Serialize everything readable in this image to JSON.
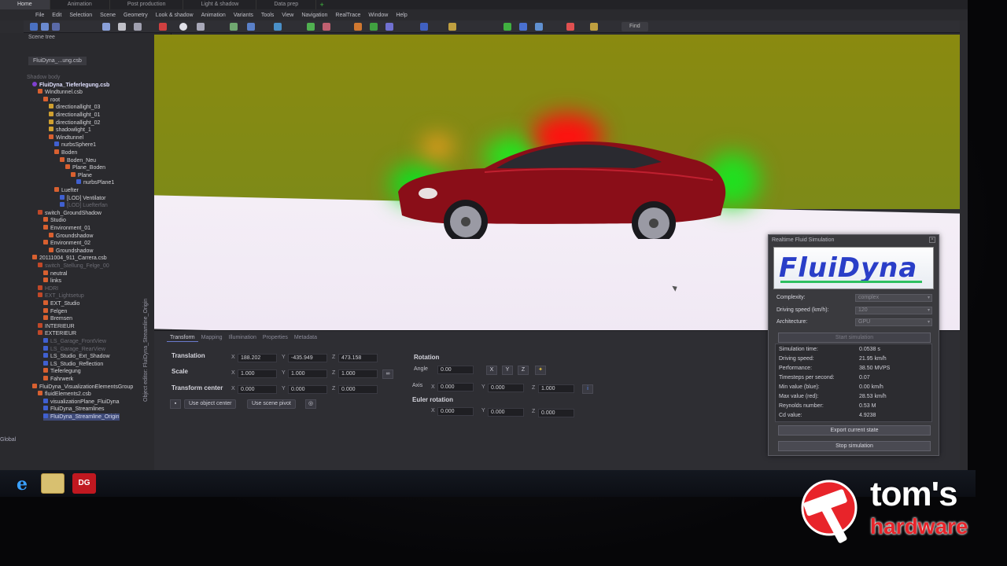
{
  "top_tabs": [
    "Home",
    "Animation",
    "Post production",
    "Light & shadow",
    "Data prep"
  ],
  "menu": [
    "File",
    "Edit",
    "Selection",
    "Scene",
    "Geometry",
    "Look & shadow",
    "Animation",
    "Variants",
    "Tools",
    "View",
    "Navigation",
    "RealTrace",
    "Window",
    "Help"
  ],
  "toolbar": {
    "find_label": "Find"
  },
  "scene_tree": {
    "title": "Scene tree",
    "file_tab": "FluiDyna_...ung.csb",
    "global_label": "Global",
    "items": [
      {
        "label": "Shadow body",
        "indent": 0,
        "icon": "none",
        "style": "dim"
      },
      {
        "label": "FluiDyna_Tieferlegung.csb",
        "indent": 1,
        "icon": "root",
        "style": "bold"
      },
      {
        "label": "Windtunnel.csb",
        "indent": 2,
        "icon": "folder",
        "style": ""
      },
      {
        "label": "root",
        "indent": 3,
        "icon": "folder",
        "style": ""
      },
      {
        "label": "directionallight_03",
        "indent": 4,
        "icon": "light",
        "style": ""
      },
      {
        "label": "directionallight_01",
        "indent": 4,
        "icon": "light",
        "style": ""
      },
      {
        "label": "directionallight_02",
        "indent": 4,
        "icon": "light",
        "style": ""
      },
      {
        "label": "shadowlight_1",
        "indent": 4,
        "icon": "light",
        "style": ""
      },
      {
        "label": "Windtunnel",
        "indent": 4,
        "icon": "folder",
        "style": ""
      },
      {
        "label": "nurbsSphere1",
        "indent": 5,
        "icon": "obj",
        "style": ""
      },
      {
        "label": "Boden",
        "indent": 5,
        "icon": "folder",
        "style": ""
      },
      {
        "label": "Boden_Neu",
        "indent": 6,
        "icon": "folder",
        "style": ""
      },
      {
        "label": "Plane_Boden",
        "indent": 7,
        "icon": "folder",
        "style": ""
      },
      {
        "label": "Plane",
        "indent": 8,
        "icon": "folder",
        "style": ""
      },
      {
        "label": "nurbsPlane1",
        "indent": 9,
        "icon": "obj",
        "style": ""
      },
      {
        "label": "Luefter",
        "indent": 5,
        "icon": "folder",
        "style": ""
      },
      {
        "label": "[LOD] Ventilator",
        "indent": 6,
        "icon": "obj",
        "style": ""
      },
      {
        "label": "[LOD] Luefterfan",
        "indent": 6,
        "icon": "obj",
        "style": "dim"
      },
      {
        "label": "switch_GroundShadow",
        "indent": 2,
        "icon": "switch",
        "style": ""
      },
      {
        "label": "Studio",
        "indent": 3,
        "icon": "folder",
        "style": ""
      },
      {
        "label": "Environment_01",
        "indent": 3,
        "icon": "folder",
        "style": ""
      },
      {
        "label": "Groundshadow",
        "indent": 4,
        "icon": "folder",
        "style": ""
      },
      {
        "label": "Environment_02",
        "indent": 3,
        "icon": "folder",
        "style": ""
      },
      {
        "label": "Groundshadow",
        "indent": 4,
        "icon": "folder",
        "style": ""
      },
      {
        "label": "20111004_911_Carrera.csb",
        "indent": 1,
        "icon": "folder",
        "style": ""
      },
      {
        "label": "switch_Stellung_Felge_00",
        "indent": 2,
        "icon": "switch",
        "style": "dim"
      },
      {
        "label": "neutral",
        "indent": 3,
        "icon": "folder",
        "style": ""
      },
      {
        "label": "links",
        "indent": 3,
        "icon": "folder",
        "style": ""
      },
      {
        "label": "HDRI",
        "indent": 2,
        "icon": "switch",
        "style": "dim"
      },
      {
        "label": "EXT_Lightsetup",
        "indent": 2,
        "icon": "switch",
        "style": "dim"
      },
      {
        "label": "EXT_Studio",
        "indent": 3,
        "icon": "folder",
        "style": ""
      },
      {
        "label": "Felgen",
        "indent": 3,
        "icon": "folder",
        "style": ""
      },
      {
        "label": "Bremsen",
        "indent": 3,
        "icon": "folder",
        "style": ""
      },
      {
        "label": "INTERIEUR",
        "indent": 2,
        "icon": "switch",
        "style": ""
      },
      {
        "label": "EXTERIEUR",
        "indent": 2,
        "icon": "switch",
        "style": ""
      },
      {
        "label": "LS_Garage_FrontView",
        "indent": 3,
        "icon": "obj",
        "style": "dim"
      },
      {
        "label": "LS_Garage_RearView",
        "indent": 3,
        "icon": "obj",
        "style": "dim"
      },
      {
        "label": "LS_Studio_Ext_Shadow",
        "indent": 3,
        "icon": "obj",
        "style": ""
      },
      {
        "label": "LS_Studio_Reflection",
        "indent": 3,
        "icon": "obj",
        "style": ""
      },
      {
        "label": "Tieferlegung",
        "indent": 3,
        "icon": "folder",
        "style": ""
      },
      {
        "label": "Fahrwerk",
        "indent": 3,
        "icon": "folder",
        "style": ""
      },
      {
        "label": "FluiDyna_VisualizationElementsGroup",
        "indent": 1,
        "icon": "folder",
        "style": ""
      },
      {
        "label": "fluidElements2.csb",
        "indent": 2,
        "icon": "folder",
        "style": ""
      },
      {
        "label": "visualizationPlane_FluiDyna",
        "indent": 3,
        "icon": "obj",
        "style": ""
      },
      {
        "label": "FluiDyna_Streamlines",
        "indent": 3,
        "icon": "obj",
        "style": ""
      },
      {
        "label": "FluiDyna_Streamline_Origin",
        "indent": 3,
        "icon": "obj",
        "style": "sel"
      }
    ]
  },
  "object_editor": {
    "side_label": "Object editor: FluiDyna_Streamline_Origin",
    "tabs": [
      "Transform",
      "Mapping",
      "Illumination",
      "Properties",
      "Metadata"
    ],
    "translation_label": "Translation",
    "scale_label": "Scale",
    "transform_center_label": "Transform center",
    "translation": {
      "x": "188.202",
      "y": "-435.949",
      "z": "473.158"
    },
    "scale": {
      "x": "1.000",
      "y": "1.000",
      "z": "1.000"
    },
    "center": {
      "x": "0.000",
      "y": "0.000",
      "z": "0.000"
    },
    "use_object_center": "Use object center",
    "use_scene_pivot": "Use scene pivot",
    "rotation_label": "Rotation",
    "angle_label": "Angle",
    "angle": "0.00",
    "axis_label": "Axis",
    "axis": {
      "x": "0.000",
      "y": "0.000",
      "z": "1.000"
    },
    "euler_label": "Euler rotation",
    "euler": {
      "x": "0.000",
      "y": "0.000",
      "z": "0.000"
    },
    "btn_x": "X",
    "btn_y": "Y",
    "btn_z": "Z",
    "axis_x": "X",
    "axis_y": "Y",
    "axis_z": "Z"
  },
  "fluid_sim": {
    "title": "Realtime Fluid Simulation",
    "logo": "FluiDyna",
    "complexity_label": "Complexity:",
    "complexity_value": "complex",
    "driving_speed_label": "Driving speed (km/h):",
    "driving_speed_value": "120",
    "architecture_label": "Architecture:",
    "architecture_value": "GPU",
    "start_button": "Start simulation",
    "stats": [
      {
        "label": "Simulation time:",
        "value": "0.0538 s"
      },
      {
        "label": "Driving speed:",
        "value": "21.95 km/h"
      },
      {
        "label": "Performance:",
        "value": "38.50 MVPS"
      },
      {
        "label": "Timesteps per second:",
        "value": "0.07"
      },
      {
        "label": "Min value (blue):",
        "value": "0.00 km/h"
      },
      {
        "label": "Max value (red):",
        "value": "28.53 km/h"
      },
      {
        "label": "Reynolds number:",
        "value": "0.53 M"
      },
      {
        "label": "Cd value:",
        "value": "4.9238"
      }
    ],
    "export_button": "Export current state",
    "stop_button": "Stop simulation"
  },
  "taskbar": {
    "apps": [
      "internet-explorer-icon",
      "file-explorer-icon",
      "deltagen-icon"
    ],
    "deltagen_label": "DG"
  },
  "watermark": {
    "brand_top": "tom's",
    "brand_bottom": "hardware"
  },
  "colors": {
    "wall": "#8a8a10",
    "floor": "#f4eef6",
    "car": "#8a0e18",
    "accent": "#2a3ec8",
    "watermark_red": "#e8242a"
  }
}
